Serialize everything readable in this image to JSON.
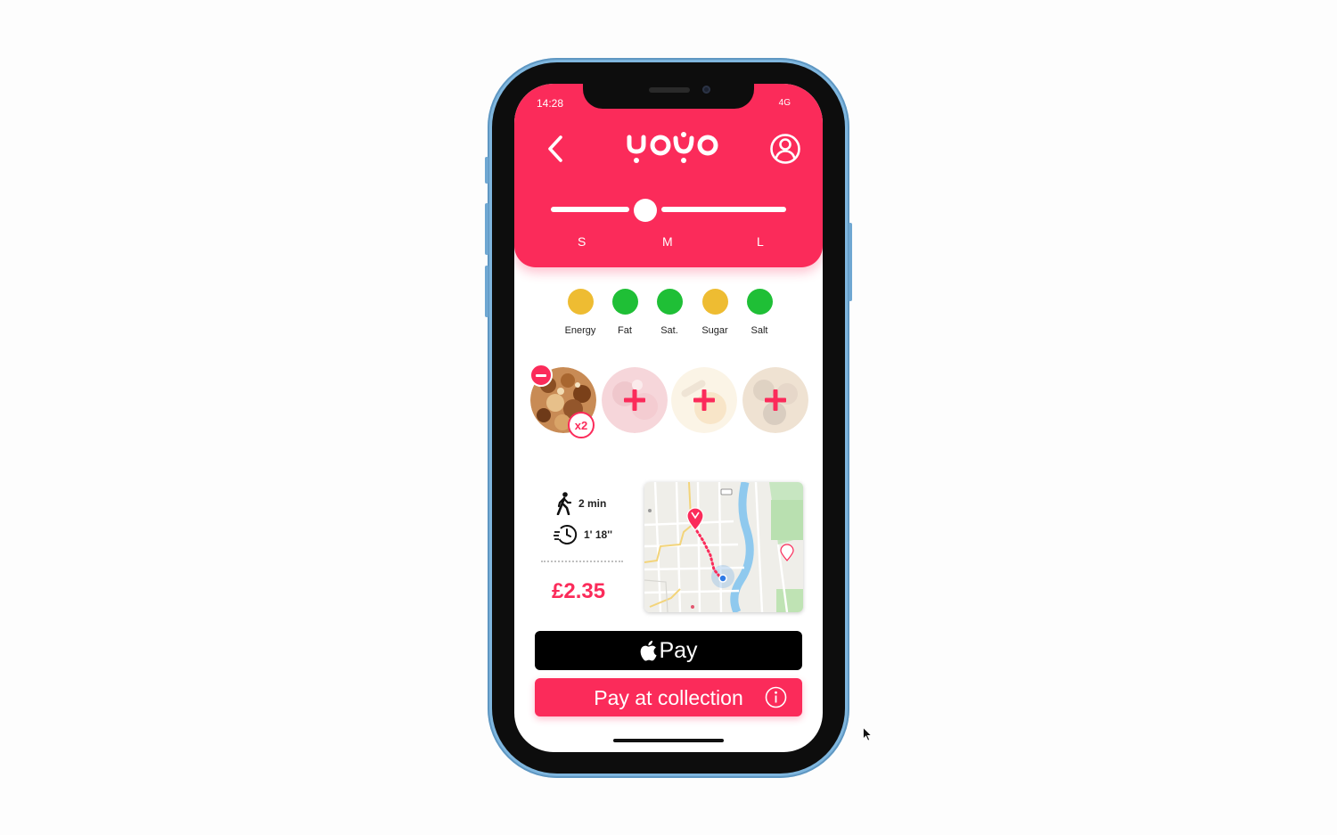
{
  "status_bar": {
    "time": "14:28",
    "network": "4G"
  },
  "header": {
    "brand": "yogo"
  },
  "size_selector": {
    "options": [
      "S",
      "M",
      "L"
    ],
    "selected": "M"
  },
  "nutrition": [
    {
      "label": "Energy",
      "color": "#eebc32"
    },
    {
      "label": "Fat",
      "color": "#1fbf36"
    },
    {
      "label": "Sat.",
      "color": "#1fbf36"
    },
    {
      "label": "Sugar",
      "color": "#eebc32"
    },
    {
      "label": "Salt",
      "color": "#1fbf36"
    }
  ],
  "toppings": {
    "selected_quantity": "x2"
  },
  "delivery": {
    "walk_time": "2 min",
    "prep_time": "1' 18''"
  },
  "price": "£2.35",
  "payment": {
    "apple_pay_label": "Pay",
    "collection_label": "Pay at collection"
  },
  "colors": {
    "brand": "#fb2b5a",
    "amber": "#eebc32",
    "green": "#1fbf36"
  }
}
